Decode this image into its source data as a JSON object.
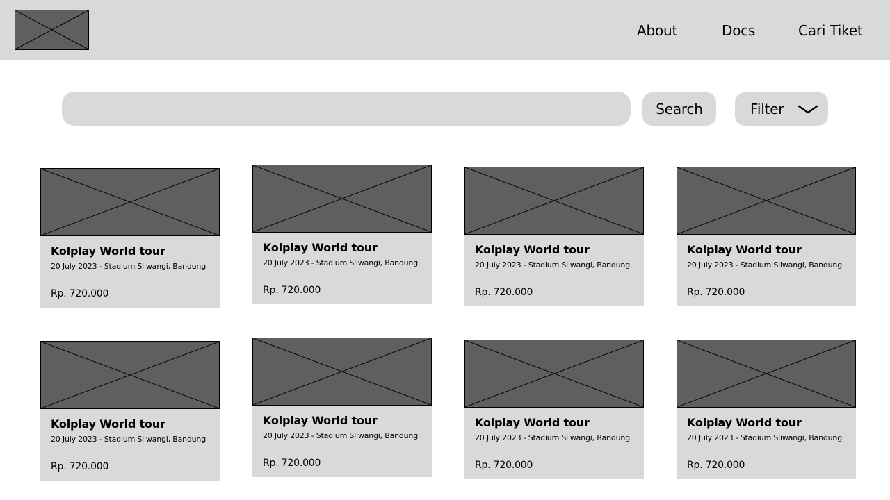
{
  "header": {
    "logo_icon": "image-placeholder-icon",
    "nav": [
      {
        "label": "About"
      },
      {
        "label": "Docs"
      },
      {
        "label": "Cari Tiket"
      }
    ]
  },
  "search": {
    "value": "",
    "placeholder": "",
    "button_label": "Search",
    "filter_label": "Filter",
    "filter_icon": "chevron-down-icon"
  },
  "colors": {
    "header_bg": "#d9d9d9",
    "placeholder_image": "#5f5f5f",
    "card_bg": "#d9d9d9"
  },
  "events": [
    {
      "image_icon": "image-placeholder-icon",
      "title": "Kolplay World tour",
      "meta": "20 July 2023 - Stadium Sliwangi, Bandung",
      "price": "Rp. 720.000"
    },
    {
      "image_icon": "image-placeholder-icon",
      "title": "Kolplay World tour",
      "meta": "20 July 2023 - Stadium Sliwangi, Bandung",
      "price": "Rp. 720.000"
    },
    {
      "image_icon": "image-placeholder-icon",
      "title": "Kolplay World tour",
      "meta": "20 July 2023 - Stadium Sliwangi, Bandung",
      "price": "Rp. 720.000"
    },
    {
      "image_icon": "image-placeholder-icon",
      "title": "Kolplay World tour",
      "meta": "20 July 2023 - Stadium Sliwangi, Bandung",
      "price": "Rp. 720.000"
    },
    {
      "image_icon": "image-placeholder-icon",
      "title": "Kolplay World tour",
      "meta": "20 July 2023 - Stadium Sliwangi, Bandung",
      "price": "Rp. 720.000"
    },
    {
      "image_icon": "image-placeholder-icon",
      "title": "Kolplay World tour",
      "meta": "20 July 2023 - Stadium Sliwangi, Bandung",
      "price": "Rp. 720.000"
    },
    {
      "image_icon": "image-placeholder-icon",
      "title": "Kolplay World tour",
      "meta": "20 July 2023 - Stadium Sliwangi, Bandung",
      "price": "Rp. 720.000"
    },
    {
      "image_icon": "image-placeholder-icon",
      "title": "Kolplay World tour",
      "meta": "20 July 2023 - Stadium Sliwangi, Bandung",
      "price": "Rp. 720.000"
    }
  ]
}
